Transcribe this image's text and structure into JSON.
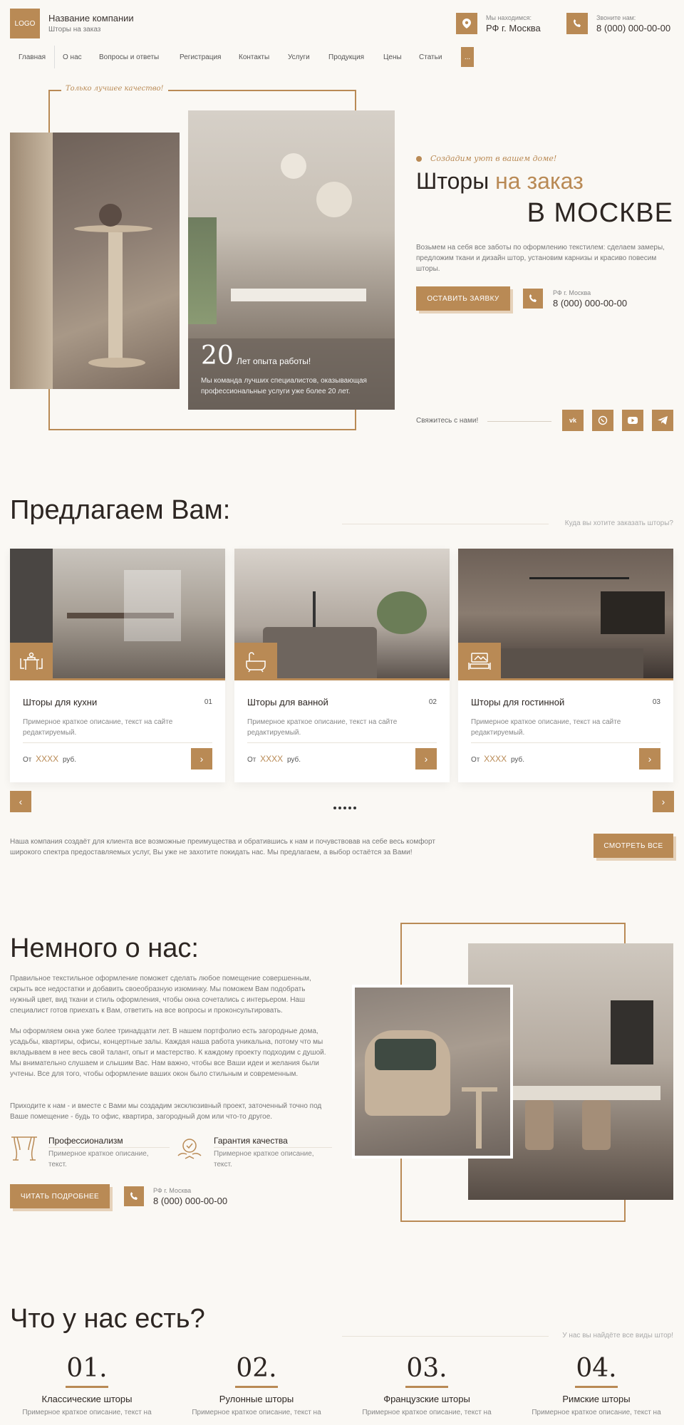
{
  "header": {
    "logo": "LOGO",
    "company_name": "Название компании",
    "tagline": "Шторы на заказ",
    "location_label": "Мы находимся:",
    "location_value": "РФ г. Москва",
    "phone_label": "Звоните нам:",
    "phone_value": "8 (000) 000-00-00"
  },
  "nav": {
    "items": [
      "Главная",
      "О нас",
      "Вопросы и ответы",
      "Регистрация",
      "Контакты",
      "Услуги",
      "Продукция",
      "Цены",
      "Статьи"
    ],
    "more": "..."
  },
  "hero": {
    "frame_note": "Только лучшее качество!",
    "eyebrow": "Создадим уют в вашем доме!",
    "title_part1": "Шторы",
    "title_part2": "на заказ",
    "title_line2": "В МОСКВЕ",
    "description": "Возьмем на себя все заботы по оформлению текстилем: сделаем замеры, предложим ткани и дизайн штор, установим карнизы и красиво повесим шторы.",
    "cta": "ОСТАВИТЬ ЗАЯВКУ",
    "contact_city": "РФ г. Москва",
    "contact_phone": "8 (000) 000-00-00",
    "years": "20",
    "years_label": "Лет опыта работы!",
    "years_text": "Мы команда лучших специалистов, оказывающая профессиональные услуги уже более 20 лет.",
    "social_label": "Свяжитесь с нами!",
    "socials": [
      "vk-icon",
      "whatsapp-icon",
      "youtube-icon",
      "telegram-icon"
    ]
  },
  "offers": {
    "title": "Предлагаем Вам:",
    "side_note": "Куда вы хотите заказать шторы?",
    "cards": [
      {
        "title": "Шторы для кухни",
        "num": "01",
        "desc": "Примерное краткое описание, текст на сайте редактируемый.",
        "price_from": "От",
        "price": "XXXX",
        "price_unit": "руб.",
        "icon": "dining-table-icon"
      },
      {
        "title": "Шторы для ванной",
        "num": "02",
        "desc": "Примерное краткое описание, текст на сайте редактируемый.",
        "price_from": "От",
        "price": "XXXX",
        "price_unit": "руб.",
        "icon": "bathtub-icon"
      },
      {
        "title": "Шторы для гостинной",
        "num": "03",
        "desc": "Примерное краткое описание, текст на сайте редактируемый.",
        "price_from": "От",
        "price": "XXXX",
        "price_unit": "руб.",
        "icon": "sofa-icon"
      }
    ],
    "text": "Наша компания создаёт для клиента все возможные преимущества и обратившись к нам и почувствовав на себе весь комфорт широкого спектра предоставляемых услуг, Вы уже не захотите покидать нас. Мы предлагаем, а выбор остаётся за Вами!",
    "see_all": "СМОТРЕТЬ ВСЕ"
  },
  "about": {
    "title": "Немного о нас:",
    "p1": "Правильное текстильное оформление поможет сделать любое помещение совершенным, скрыть все недостатки и добавить своеобразную изюминку. Мы поможем Вам подобрать нужный цвет, вид ткани и стиль оформления, чтобы окна сочетались с интерьером. Наш специалист готов приехать к Вам, ответить на все вопросы и проконсультировать.",
    "p2": "Мы оформляем окна уже более тринадцати лет. В нашем портфолио есть загородные дома, усадьбы, квартиры, офисы, концертные залы. Каждая наша работа уникальна, потому что мы вкладываем в нее весь свой талант, опыт и мастерство. К каждому проекту подходим с душой. Мы внимательно слушаем и слышим Вас. Нам важно, чтобы все Ваши идеи и желания были учтены. Все для того, чтобы оформление ваших окон было стильным и современным.",
    "p3": "Приходите к нам - и вместе с Вами мы создадим эксклюзивный проект, заточенный точно под Ваше помещение - будь то офис, квартира, загородный дом или что-то другое.",
    "features": [
      {
        "title": "Профессионализм",
        "desc": "Примерное краткое описание, текст.",
        "icon": "curtains-icon"
      },
      {
        "title": "Гарантия качества",
        "desc": "Примерное краткое описание, текст.",
        "icon": "quality-badge-icon"
      }
    ],
    "cta": "ЧИТАТЬ ПОДРОБНЕЕ",
    "contact_city": "РФ г. Москва",
    "contact_phone": "8 (000) 000-00-00"
  },
  "types": {
    "title": "Что у нас есть?",
    "side_note": "У нас вы найдёте все виды штор!",
    "items": [
      {
        "num": "01.",
        "title": "Классические шторы",
        "desc": "Примерное краткое описание, текст на"
      },
      {
        "num": "02.",
        "title": "Рулонные шторы",
        "desc": "Примерное краткое описание, текст на"
      },
      {
        "num": "03.",
        "title": "Французские шторы",
        "desc": "Примерное краткое описание, текст на"
      },
      {
        "num": "04.",
        "title": "Римские шторы",
        "desc": "Примерное краткое описание, текст на"
      }
    ]
  },
  "colors": {
    "accent": "#b98a55",
    "background": "#faf8f4",
    "text": "#3a3330"
  }
}
